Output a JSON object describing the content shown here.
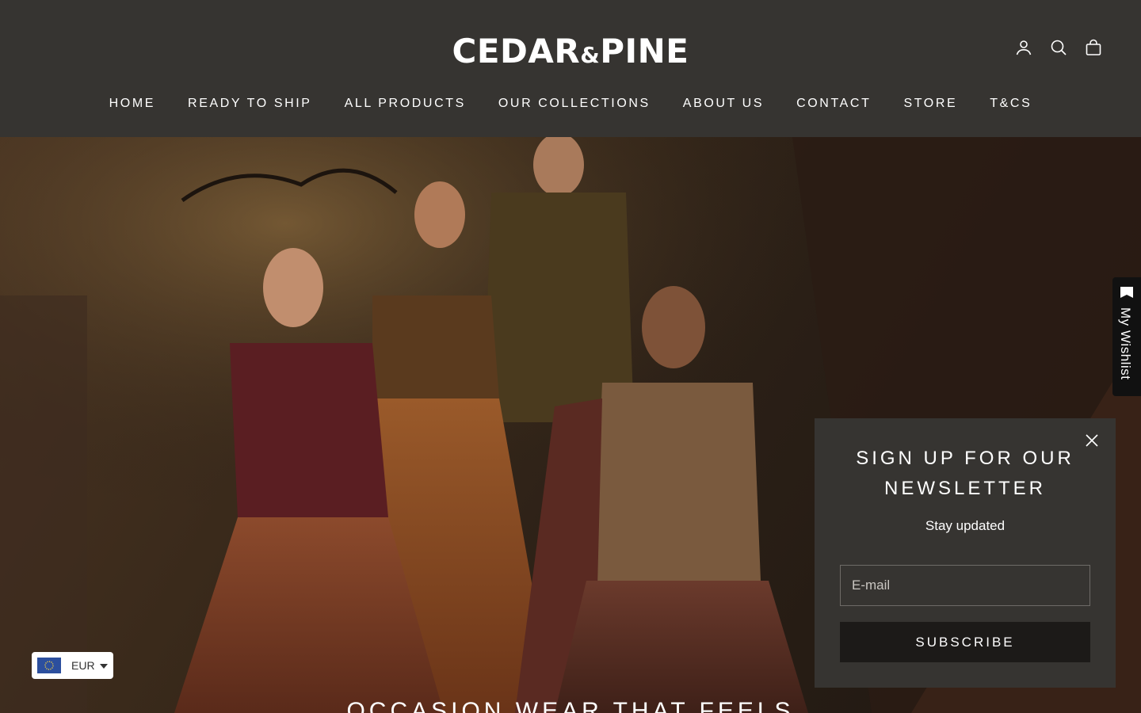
{
  "brand": {
    "name_part1": "CEDAR",
    "ampersand": "&",
    "name_part2": "PINE"
  },
  "header_icons": [
    "account-icon",
    "search-icon",
    "cart-icon"
  ],
  "nav": [
    "HOME",
    "READY TO SHIP",
    "ALL PRODUCTS",
    "OUR COLLECTIONS",
    "ABOUT US",
    "CONTACT",
    "STORE",
    "T&CS"
  ],
  "hero": {
    "heading": "OCCASION WEAR THAT FEELS"
  },
  "wishlist": {
    "label": "My Wishlist"
  },
  "newsletter": {
    "title": "SIGN UP FOR OUR NEWSLETTER",
    "subtitle": "Stay updated",
    "email_placeholder": "E-mail",
    "button_label": "SUBSCRIBE"
  },
  "currency": {
    "code": "EUR"
  },
  "colors": {
    "header_bg": "#363431",
    "popup_bg": "#363431",
    "button_bg": "#1c1a18",
    "flag_blue": "#2c4f9e"
  }
}
